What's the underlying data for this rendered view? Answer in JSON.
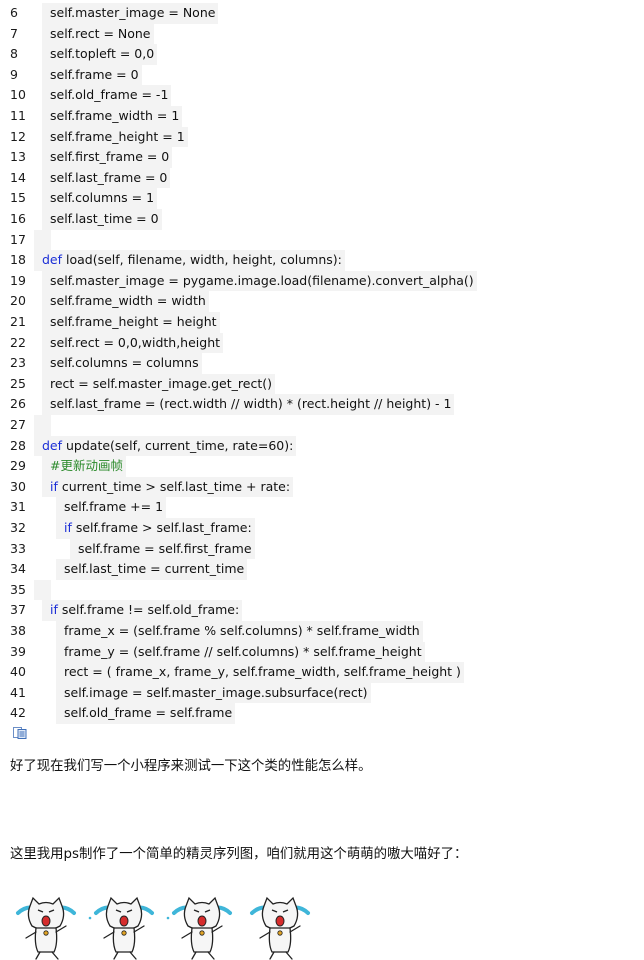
{
  "code": {
    "lines": [
      {
        "n": "6",
        "indent": 1,
        "parts": [
          {
            "t": "self.master_image = None"
          }
        ]
      },
      {
        "n": "7",
        "indent": 1,
        "parts": [
          {
            "t": "self.rect = None"
          }
        ]
      },
      {
        "n": "8",
        "indent": 1,
        "parts": [
          {
            "t": "self.topleft = 0,0"
          }
        ]
      },
      {
        "n": "9",
        "indent": 1,
        "parts": [
          {
            "t": "self.frame = 0"
          }
        ]
      },
      {
        "n": "10",
        "indent": 1,
        "parts": [
          {
            "t": "self.old_frame = -1"
          }
        ]
      },
      {
        "n": "11",
        "indent": 1,
        "parts": [
          {
            "t": "self.frame_width = 1"
          }
        ]
      },
      {
        "n": "12",
        "indent": 1,
        "parts": [
          {
            "t": "self.frame_height = 1"
          }
        ]
      },
      {
        "n": "13",
        "indent": 1,
        "parts": [
          {
            "t": "self.first_frame = 0"
          }
        ]
      },
      {
        "n": "14",
        "indent": 1,
        "parts": [
          {
            "t": "self.last_frame = 0"
          }
        ]
      },
      {
        "n": "15",
        "indent": 1,
        "parts": [
          {
            "t": "self.columns = 1"
          }
        ]
      },
      {
        "n": "16",
        "indent": 1,
        "parts": [
          {
            "t": "self.last_time = 0"
          }
        ]
      },
      {
        "n": "17",
        "indent": 0,
        "parts": []
      },
      {
        "n": "18",
        "indent": 0,
        "parts": [
          {
            "t": "def",
            "k": "kw"
          },
          {
            "t": " load(self, filename, width, height, columns):"
          }
        ]
      },
      {
        "n": "19",
        "indent": 1,
        "parts": [
          {
            "t": "self.master_image = pygame.image.load(filename).convert_alpha()"
          }
        ]
      },
      {
        "n": "20",
        "indent": 1,
        "parts": [
          {
            "t": "self.frame_width = width"
          }
        ]
      },
      {
        "n": "21",
        "indent": 1,
        "parts": [
          {
            "t": "self.frame_height = height"
          }
        ]
      },
      {
        "n": "22",
        "indent": 1,
        "parts": [
          {
            "t": "self.rect = 0,0,width,height"
          }
        ]
      },
      {
        "n": "23",
        "indent": 1,
        "parts": [
          {
            "t": "self.columns = columns"
          }
        ]
      },
      {
        "n": "25",
        "indent": 1,
        "parts": [
          {
            "t": "rect = self.master_image.get_rect()"
          }
        ]
      },
      {
        "n": "26",
        "indent": 1,
        "parts": [
          {
            "t": "self.last_frame = (rect.width // width) * (rect.height // height) - 1"
          }
        ]
      },
      {
        "n": "27",
        "indent": 0,
        "parts": []
      },
      {
        "n": "28",
        "indent": 0,
        "parts": [
          {
            "t": "def",
            "k": "kw"
          },
          {
            "t": " update(self, current_time, rate=60):"
          }
        ]
      },
      {
        "n": "29",
        "indent": 1,
        "parts": [
          {
            "t": "#更新动画帧",
            "k": "cm"
          }
        ]
      },
      {
        "n": "30",
        "indent": 1,
        "parts": [
          {
            "t": "if",
            "k": "kw"
          },
          {
            "t": " current_time > self.last_time + rate:"
          }
        ]
      },
      {
        "n": "31",
        "indent": 2,
        "parts": [
          {
            "t": "self.frame += 1"
          }
        ]
      },
      {
        "n": "32",
        "indent": 2,
        "parts": [
          {
            "t": "if",
            "k": "kw"
          },
          {
            "t": " self.frame > self.last_frame:"
          }
        ]
      },
      {
        "n": "33",
        "indent": 3,
        "parts": [
          {
            "t": "self.frame = self.first_frame"
          }
        ]
      },
      {
        "n": "34",
        "indent": 2,
        "parts": [
          {
            "t": "self.last_time = current_time"
          }
        ]
      },
      {
        "n": "35",
        "indent": 0,
        "parts": []
      },
      {
        "n": "37",
        "indent": 1,
        "parts": [
          {
            "t": "if",
            "k": "kw"
          },
          {
            "t": " self.frame != self.old_frame:"
          }
        ]
      },
      {
        "n": "38",
        "indent": 2,
        "parts": [
          {
            "t": "frame_x = (self.frame % self.columns) * self.frame_width"
          }
        ]
      },
      {
        "n": "39",
        "indent": 2,
        "parts": [
          {
            "t": "frame_y = (self.frame // self.columns) * self.frame_height"
          }
        ]
      },
      {
        "n": "40",
        "indent": 2,
        "parts": [
          {
            "t": "rect = ( frame_x, frame_y, self.frame_width, self.frame_height )"
          }
        ]
      },
      {
        "n": "41",
        "indent": 2,
        "parts": [
          {
            "t": "self.image = self.master_image.subsurface(rect)"
          }
        ]
      },
      {
        "n": "42",
        "indent": 2,
        "parts": [
          {
            "t": "self.old_frame = self.frame"
          }
        ]
      }
    ]
  },
  "icons": {
    "copy": "copy-icon"
  },
  "text": {
    "para1": "好了现在我们写一个小程序来测试一下这个类的性能怎么样。",
    "para2": "这里我用ps制作了一个简单的精灵序列图，咱们就用这个萌萌的嗷大喵好了："
  }
}
